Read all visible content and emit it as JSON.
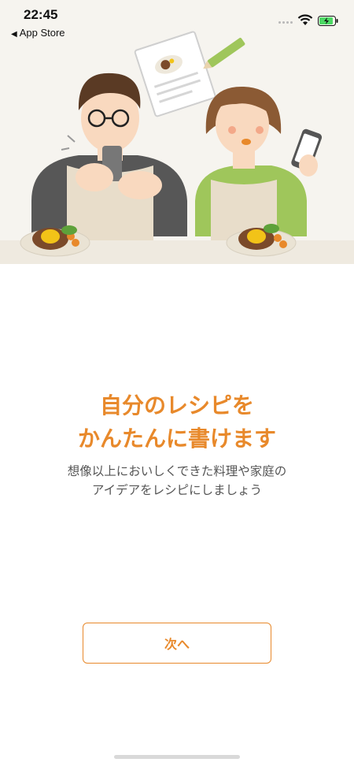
{
  "status_bar": {
    "time": "22:45",
    "back_label": "App Store"
  },
  "onboarding": {
    "title_line1": "自分のレシピを",
    "title_line2": "かんたんに書けます",
    "subtitle_line1": "想像以上においしくできた料理や家庭の",
    "subtitle_line2": "アイデアをレシピにしましょう",
    "next_label": "次へ"
  },
  "colors": {
    "accent": "#e8892b",
    "hero_bg": "#f6f4ef",
    "text_gray": "#555555"
  }
}
